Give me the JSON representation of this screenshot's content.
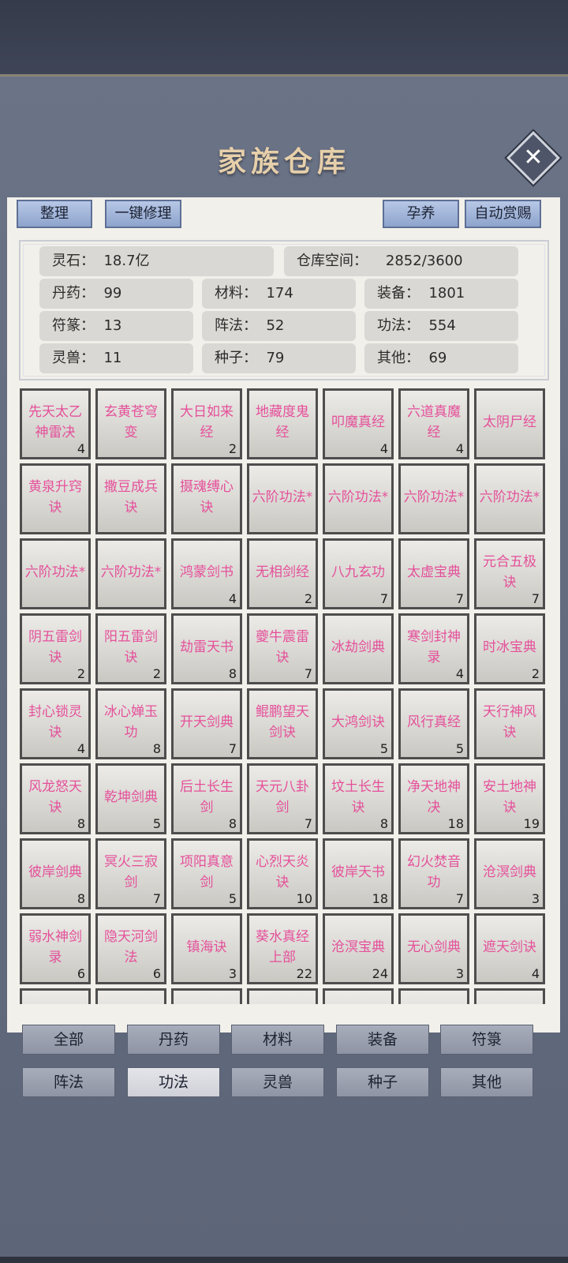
{
  "title": "家族仓库",
  "close_label": "✕",
  "toolbar": {
    "organize": "整理",
    "repair_all": "一键修理",
    "nurture": "孕养",
    "auto_reward": "自动赏赐"
  },
  "stats": {
    "spirit_stone": "灵石：  18.7亿",
    "storage": "仓库空间：    2852/3600",
    "pills": "丹药：  99",
    "materials": "材料：  174",
    "equipment": "装备：  1801",
    "talismans": "符篆：  13",
    "formations": "阵法：  52",
    "techniques": "功法：  554",
    "beasts": "灵兽：  11",
    "seeds": "种子：  79",
    "others": "其他：  69"
  },
  "items": [
    {
      "name": "先天太乙神雷决",
      "count": "4"
    },
    {
      "name": "玄黄苍穹变",
      "count": ""
    },
    {
      "name": "大日如来经",
      "count": "2"
    },
    {
      "name": "地藏度鬼经",
      "count": ""
    },
    {
      "name": "叩魔真经",
      "count": "4"
    },
    {
      "name": "六道真魔经",
      "count": "4"
    },
    {
      "name": "太阴尸经",
      "count": ""
    },
    {
      "name": "黄泉升窍诀",
      "count": ""
    },
    {
      "name": "撒豆成兵诀",
      "count": ""
    },
    {
      "name": "摄魂缚心诀",
      "count": ""
    },
    {
      "name": "六阶功法*",
      "count": ""
    },
    {
      "name": "六阶功法*",
      "count": ""
    },
    {
      "name": "六阶功法*",
      "count": ""
    },
    {
      "name": "六阶功法*",
      "count": ""
    },
    {
      "name": "六阶功法*",
      "count": ""
    },
    {
      "name": "六阶功法*",
      "count": ""
    },
    {
      "name": "鸿蒙剑书",
      "count": "4"
    },
    {
      "name": "无相剑经",
      "count": "2"
    },
    {
      "name": "八九玄功",
      "count": "7"
    },
    {
      "name": "太虚宝典",
      "count": "7"
    },
    {
      "name": "元合五极诀",
      "count": "7"
    },
    {
      "name": "阴五雷剑诀",
      "count": "2"
    },
    {
      "name": "阳五雷剑诀",
      "count": "2"
    },
    {
      "name": "劫雷天书",
      "count": "8"
    },
    {
      "name": "夔牛震雷诀",
      "count": "7"
    },
    {
      "name": "冰劫剑典",
      "count": ""
    },
    {
      "name": "寒剑封神录",
      "count": "4"
    },
    {
      "name": "时冰宝典",
      "count": "2"
    },
    {
      "name": "封心锁灵诀",
      "count": "4"
    },
    {
      "name": "冰心婵玉功",
      "count": "8"
    },
    {
      "name": "开天剑典",
      "count": "7"
    },
    {
      "name": "鲲鹏望天剑诀",
      "count": ""
    },
    {
      "name": "大鸿剑诀",
      "count": "5"
    },
    {
      "name": "风行真经",
      "count": "5"
    },
    {
      "name": "天行神风诀",
      "count": ""
    },
    {
      "name": "风龙怒天诀",
      "count": "8"
    },
    {
      "name": "乾坤剑典",
      "count": "5"
    },
    {
      "name": "后土长生剑",
      "count": "8"
    },
    {
      "name": "天元八卦剑",
      "count": "7"
    },
    {
      "name": "坟土长生诀",
      "count": "8"
    },
    {
      "name": "净天地神决",
      "count": "18"
    },
    {
      "name": "安土地神诀",
      "count": "19"
    },
    {
      "name": "彼岸剑典",
      "count": "8"
    },
    {
      "name": "冥火三寂剑",
      "count": "7"
    },
    {
      "name": "项阳真意剑",
      "count": "5"
    },
    {
      "name": "心烈天炎诀",
      "count": "10"
    },
    {
      "name": "彼岸天书",
      "count": "18"
    },
    {
      "name": "幻火焚音功",
      "count": "7"
    },
    {
      "name": "沧溟剑典",
      "count": "3"
    },
    {
      "name": "弱水神剑录",
      "count": "6"
    },
    {
      "name": "隐天河剑法",
      "count": "6"
    },
    {
      "name": "镇海诀",
      "count": "3"
    },
    {
      "name": "葵水真经上部",
      "count": "22"
    },
    {
      "name": "沧溟宝典",
      "count": "24"
    },
    {
      "name": "无心剑典",
      "count": "3"
    },
    {
      "name": "遮天剑诀",
      "count": "4"
    },
    {
      "name": "",
      "count": ""
    },
    {
      "name": "",
      "count": ""
    },
    {
      "name": "",
      "count": ""
    },
    {
      "name": "",
      "count": ""
    },
    {
      "name": "",
      "count": ""
    },
    {
      "name": "",
      "count": ""
    },
    {
      "name": "",
      "count": ""
    }
  ],
  "tabs": [
    {
      "label": "全部"
    },
    {
      "label": "丹药"
    },
    {
      "label": "材料"
    },
    {
      "label": "装备"
    },
    {
      "label": "符箓"
    },
    {
      "label": "阵法"
    },
    {
      "label": "功法"
    },
    {
      "label": "灵兽"
    },
    {
      "label": "种子"
    },
    {
      "label": "其他"
    }
  ],
  "active_tab": "功法",
  "colors": {
    "item_text": "#e5509a",
    "panel": "#646c80",
    "title": "#e6cfaa"
  }
}
